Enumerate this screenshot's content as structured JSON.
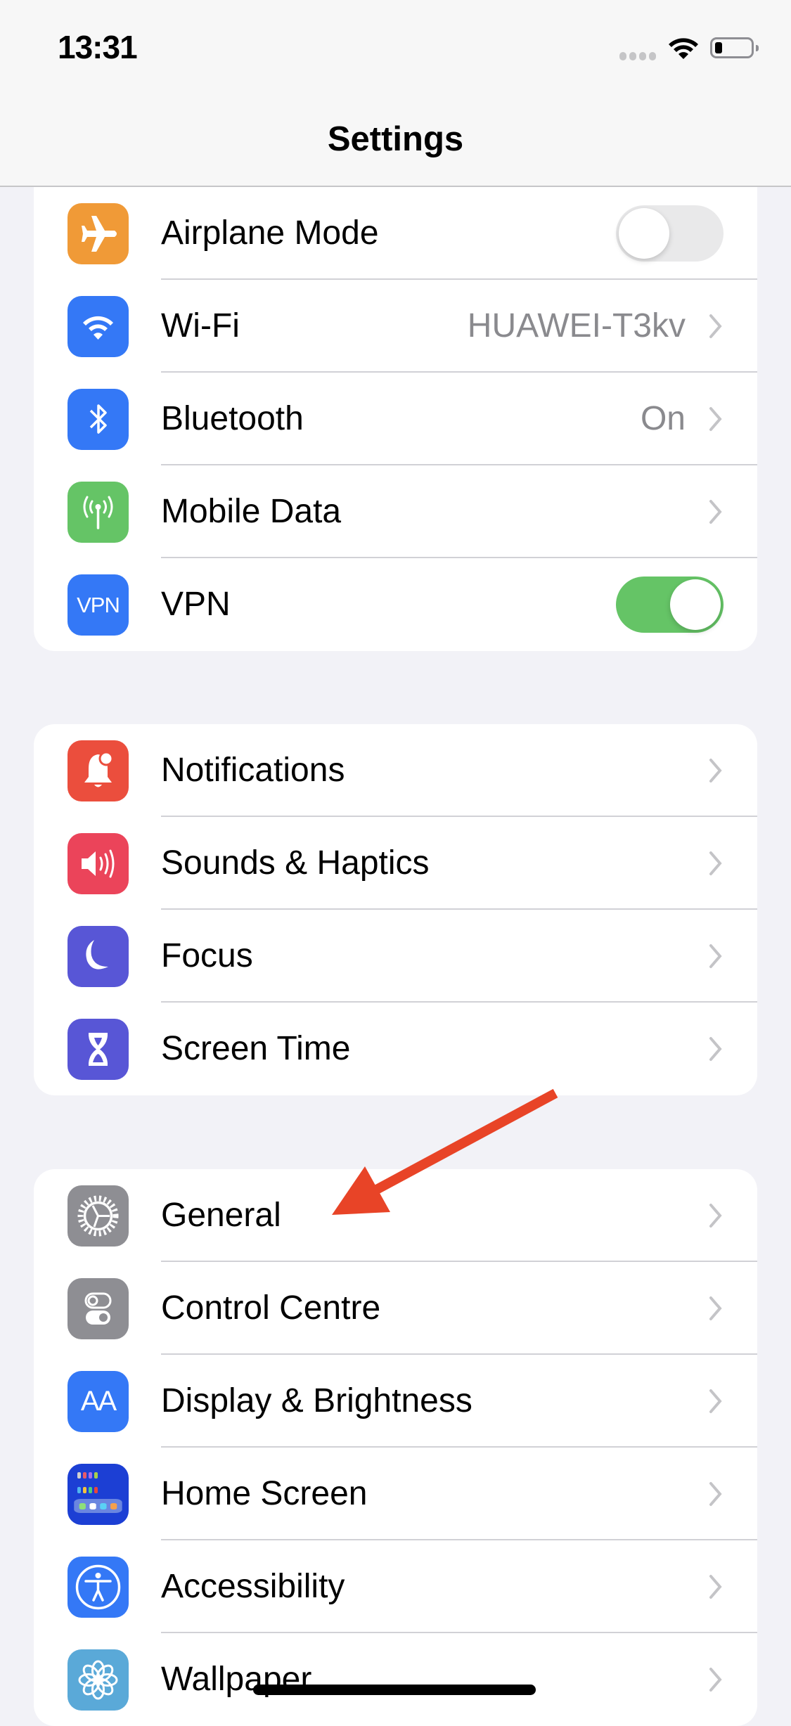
{
  "status_bar": {
    "time": "13:31",
    "signal": "no-service",
    "wifi": "connected",
    "battery_level_percent": 20
  },
  "header": {
    "title": "Settings"
  },
  "groups": [
    {
      "rows": [
        {
          "label": "Airplane Mode",
          "icon": "airplane-icon",
          "icon_color": "#f09a37",
          "control": "toggle",
          "toggle_on": false
        },
        {
          "label": "Wi-Fi",
          "icon": "wifi-icon",
          "icon_color": "#3478f6",
          "value": "HUAWEI-T3kv",
          "control": "chevron"
        },
        {
          "label": "Bluetooth",
          "icon": "bluetooth-icon",
          "icon_color": "#3478f6",
          "value": "On",
          "control": "chevron"
        },
        {
          "label": "Mobile Data",
          "icon": "antenna-icon",
          "icon_color": "#65c466",
          "control": "chevron"
        },
        {
          "label": "VPN",
          "icon": "vpn-icon",
          "icon_text": "VPN",
          "icon_color": "#3478f6",
          "control": "toggle",
          "toggle_on": true
        }
      ]
    },
    {
      "rows": [
        {
          "label": "Notifications",
          "icon": "bell-icon",
          "icon_color": "#eb4e3d",
          "control": "chevron"
        },
        {
          "label": "Sounds & Haptics",
          "icon": "speaker-icon",
          "icon_color": "#eb445a",
          "control": "chevron"
        },
        {
          "label": "Focus",
          "icon": "moon-icon",
          "icon_color": "#5856d6",
          "control": "chevron"
        },
        {
          "label": "Screen Time",
          "icon": "hourglass-icon",
          "icon_color": "#5856d6",
          "control": "chevron"
        }
      ]
    },
    {
      "rows": [
        {
          "label": "General",
          "icon": "gear-icon",
          "icon_color": "#8e8e93",
          "control": "chevron"
        },
        {
          "label": "Control Centre",
          "icon": "switches-icon",
          "icon_color": "#8e8e93",
          "control": "chevron"
        },
        {
          "label": "Display & Brightness",
          "icon": "text-size-icon",
          "icon_text": "AA",
          "icon_color": "#3478f6",
          "control": "chevron"
        },
        {
          "label": "Home Screen",
          "icon": "home-screen-icon",
          "icon_color": "#1c3fd4",
          "control": "chevron"
        },
        {
          "label": "Accessibility",
          "icon": "accessibility-icon",
          "icon_color": "#3478f6",
          "control": "chevron"
        },
        {
          "label": "Wallpaper",
          "icon": "flower-icon",
          "icon_color": "#5aa9d8",
          "control": "chevron"
        }
      ]
    }
  ],
  "annotation": {
    "type": "arrow",
    "color": "#e84427",
    "points_to": "General"
  },
  "colors": {
    "background": "#f2f2f7",
    "toggle_on": "#65c466",
    "toggle_off": "#e9e9ea",
    "secondary_text": "#8a8a8e",
    "chevron": "#c4c4c7"
  }
}
